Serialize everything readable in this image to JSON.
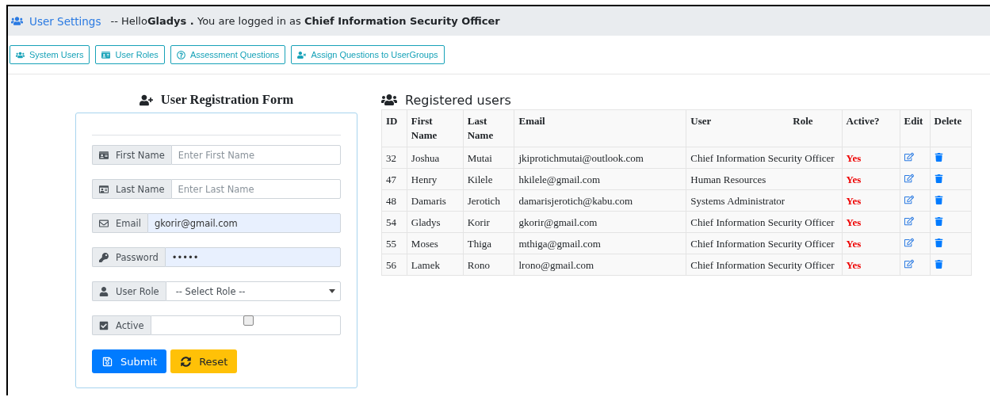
{
  "header": {
    "link": "User Settings",
    "greeting": "-- Hello**Gladys .** You are logged in as **Chief Information Security Officer**"
  },
  "tabs": [
    {
      "label": "System Users"
    },
    {
      "label": "User Roles"
    },
    {
      "label": "Assessment Questions"
    },
    {
      "label": "Assign Questions to UserGroups"
    }
  ],
  "form": {
    "title": "User Registration Form",
    "fields": [
      {
        "kind": "text",
        "label": "First Name",
        "placeholder": "Enter First Name",
        "autofilled": false
      },
      {
        "kind": "text",
        "label": "Last Name",
        "placeholder": "Enter Last Name",
        "autofilled": false
      },
      {
        "kind": "text",
        "label": "Email",
        "value": "gkorir@gmail.com",
        "autofilled": true
      },
      {
        "kind": "password",
        "label": "Password",
        "value": "•••••",
        "autofilled": true
      },
      {
        "kind": "select",
        "label": "User Role",
        "value": "-- Select Role --"
      },
      {
        "kind": "checkbox",
        "label": "Active",
        "checked": false
      }
    ],
    "buttons": [
      {
        "kind": "primary",
        "label": "Submit"
      },
      {
        "kind": "warning",
        "label": "Reset"
      }
    ]
  },
  "table": {
    "title": "Registered users",
    "columns": [
      "ID",
      "First Name",
      "Last Name",
      "Email",
      "User Role",
      "Active?",
      "Edit",
      "Delete"
    ],
    "rows": [
      {
        "id": "32",
        "first": "Joshua",
        "last": "Mutai",
        "email": "jkiprotichmutai@outlook.com",
        "role": "Chief Information Security Officer",
        "active": "Yes"
      },
      {
        "id": "47",
        "first": "Henry",
        "last": "Kilele",
        "email": "hkilele@gmail.com",
        "role": "Human Resources",
        "active": "Yes"
      },
      {
        "id": "48",
        "first": "Damaris",
        "last": "Jerotich",
        "email": "damarisjerotich@kabu.com",
        "role": "Systems Administrator",
        "active": "Yes"
      },
      {
        "id": "54",
        "first": "Gladys",
        "last": "Korir",
        "email": "gkorir@gmail.com",
        "role": "Chief Information Security Officer",
        "active": "Yes"
      },
      {
        "id": "55",
        "first": "Moses",
        "last": "Thiga",
        "email": "mthiga@gmail.com",
        "role": "Chief Information Security Officer",
        "active": "Yes"
      },
      {
        "id": "56",
        "first": "Lamek",
        "last": "Rono",
        "email": "lrono@gmail.com",
        "role": "Chief Information Security Officer",
        "active": "Yes"
      }
    ]
  }
}
